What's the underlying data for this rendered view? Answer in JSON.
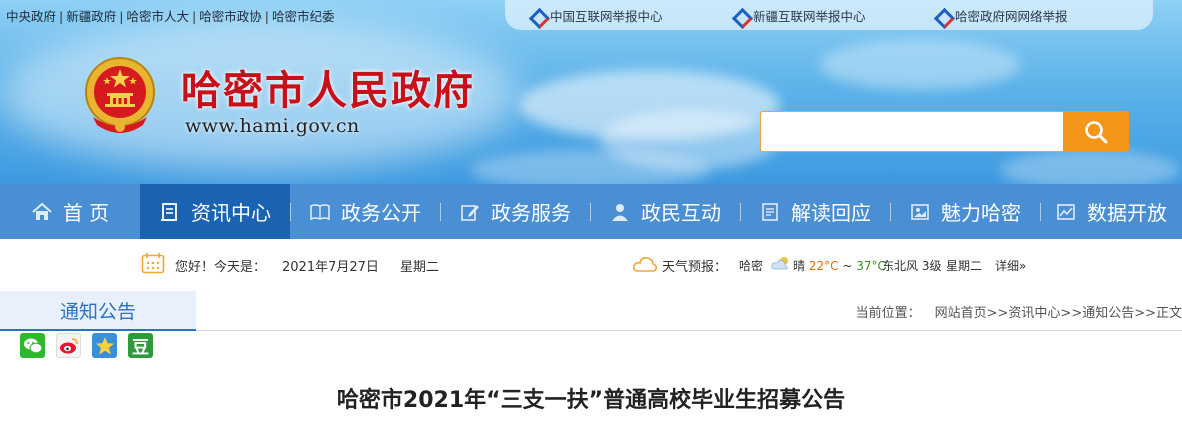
{
  "top_links": [
    "中央政府",
    "新疆政府",
    "哈密市人大",
    "哈密市政协",
    "哈密市纪委"
  ],
  "report_links": [
    "中国互联网举报中心",
    "新疆互联网举报中心",
    "哈密政府网网络举报"
  ],
  "site": {
    "title": "哈密市人民政府",
    "url": "www.hami.gov.cn"
  },
  "search": {
    "placeholder": "",
    "value": ""
  },
  "nav": [
    {
      "label": "首 页",
      "icon": "home-icon"
    },
    {
      "label": "资讯中心",
      "icon": "news-icon"
    },
    {
      "label": "政务公开",
      "icon": "book-icon"
    },
    {
      "label": "政务服务",
      "icon": "edit-icon"
    },
    {
      "label": "政民互动",
      "icon": "person-icon"
    },
    {
      "label": "解读回应",
      "icon": "document-icon"
    },
    {
      "label": "魅力哈密",
      "icon": "photo-icon"
    },
    {
      "label": "数据开放",
      "icon": "chart-icon"
    }
  ],
  "nav_active_index": 1,
  "info": {
    "greeting": "您好！今天是：",
    "date": "2021年7月27日",
    "weekday": "星期二"
  },
  "weather": {
    "label": "天气预报：",
    "city": "哈密",
    "condition": "晴",
    "temp_low": "22°C",
    "range_sep": "~",
    "temp_high": "37°C",
    "wind": "东北风 3级",
    "day": "星期二",
    "detail": "详细»"
  },
  "section": {
    "tab": "通知公告",
    "location_label": "当前位置：",
    "breadcrumb": "网站首页>>资讯中心>>通知公告>>正文"
  },
  "share": [
    "wechat-icon",
    "weibo-icon",
    "qzone-icon",
    "douban-icon"
  ],
  "share_douban_char": "豆",
  "article": {
    "title": "哈密市2021年“三支一扶”普通高校毕业生招募公告"
  },
  "colors": {
    "title_red": "#c8101a",
    "nav_blue": "#4a8fd4",
    "nav_active": "#1a63b3",
    "search_orange": "#f5961b",
    "section_blue": "#2a72c4"
  }
}
